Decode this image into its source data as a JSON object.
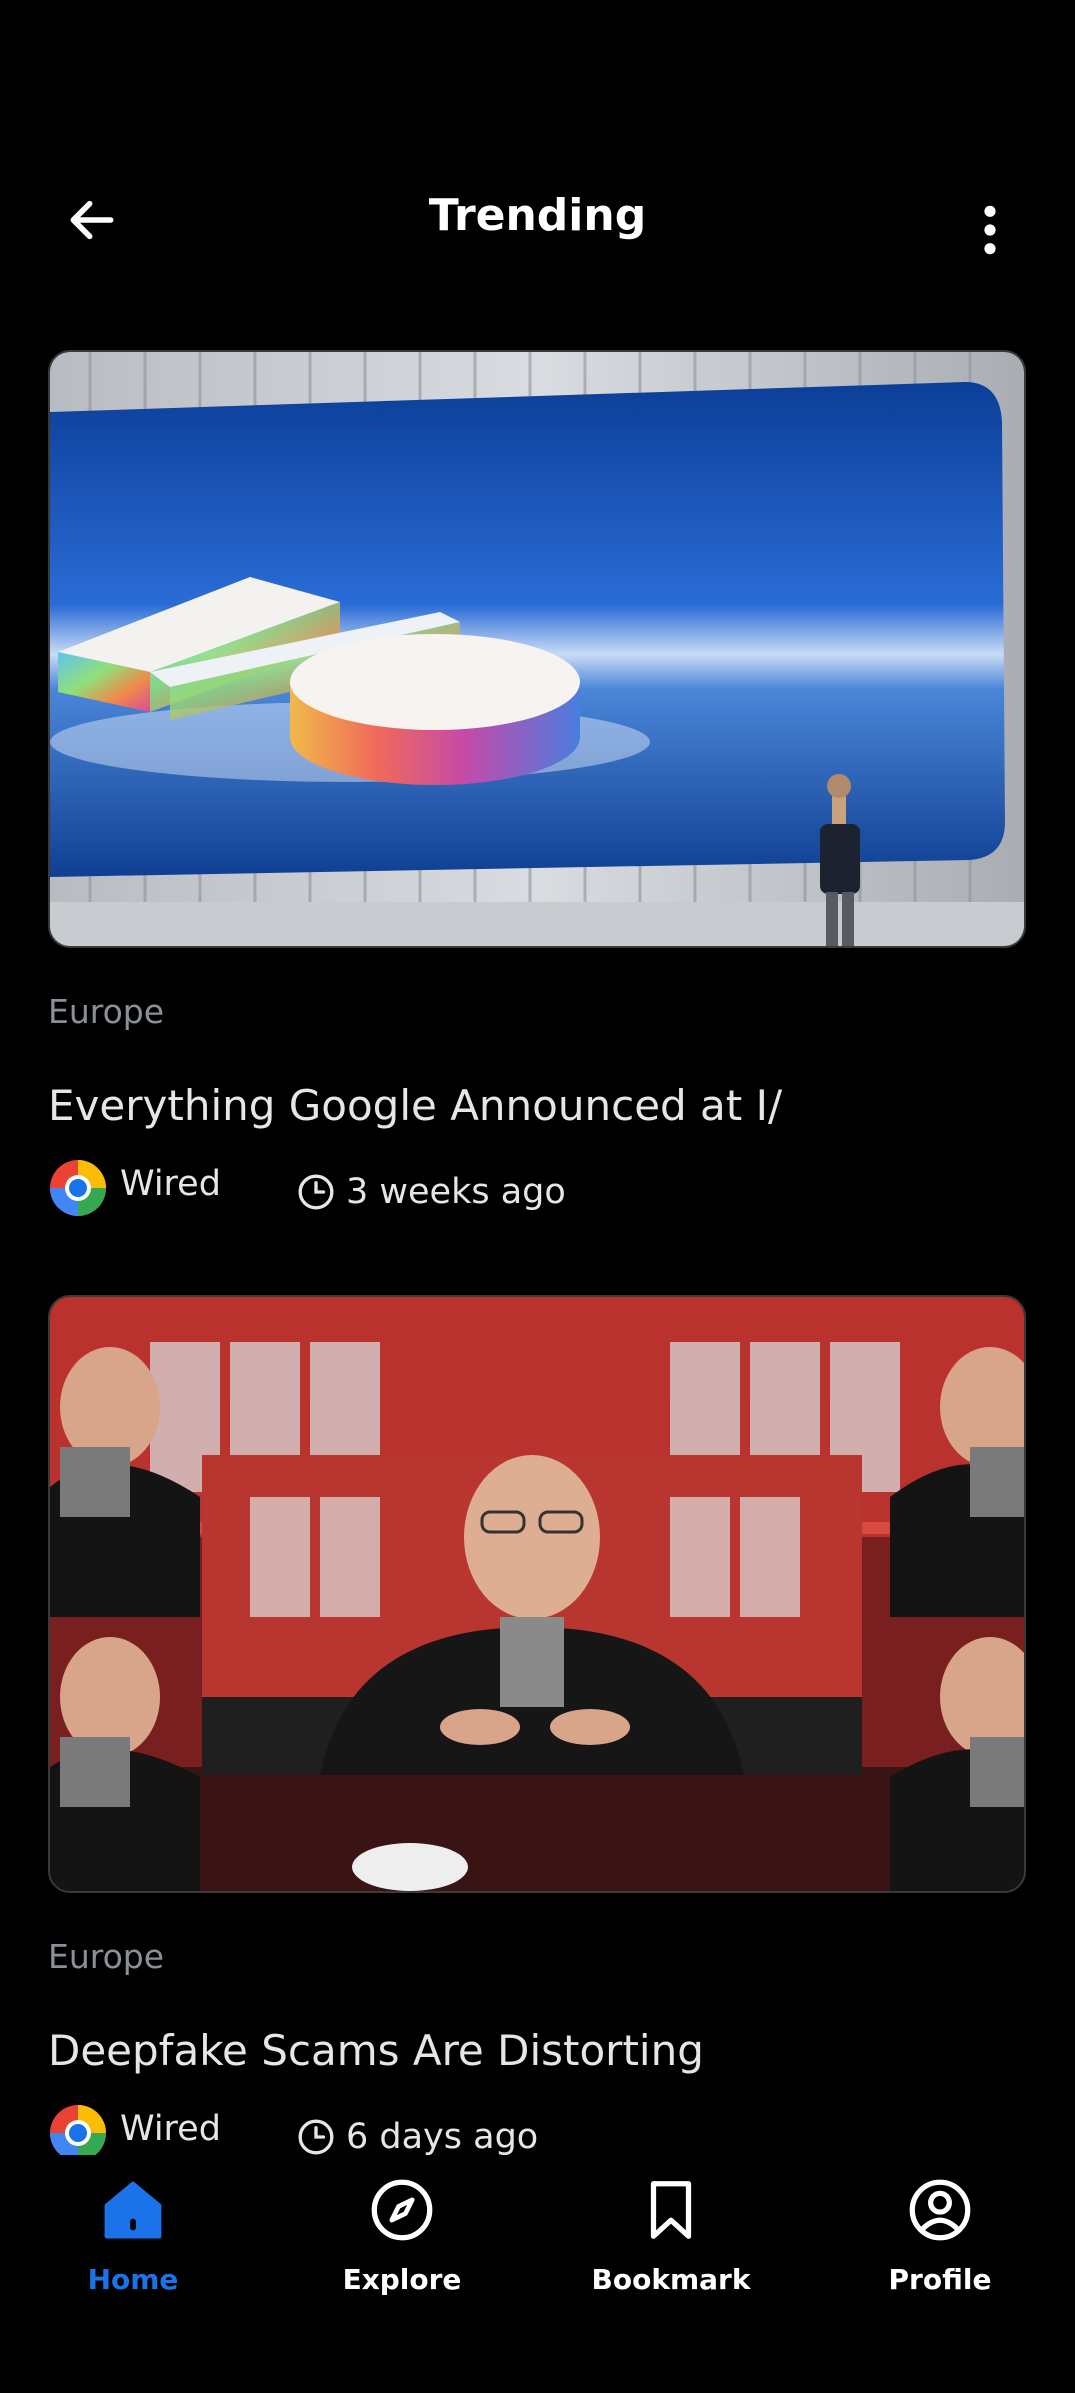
{
  "header": {
    "title": "Trending",
    "back_icon": "arrow-left-icon",
    "more_icon": "more-vertical-icon"
  },
  "articles": [
    {
      "category": "Europe",
      "headline": "Everything Google Announced at I/",
      "source": "Wired",
      "time_ago": "3 weeks ago",
      "image": "stage-keynote-image"
    },
    {
      "category": "Europe",
      "headline": "Deepfake Scams Are Distorting",
      "source": "Wired",
      "time_ago": "6 days ago",
      "image": "deepfake-collage-image"
    }
  ],
  "bottom_nav": {
    "items": [
      {
        "label": "Home",
        "icon": "home-icon",
        "active": true
      },
      {
        "label": "Explore",
        "icon": "compass-icon",
        "active": false
      },
      {
        "label": "Bookmark",
        "icon": "bookmark-icon",
        "active": false
      },
      {
        "label": "Profile",
        "icon": "profile-icon",
        "active": false
      }
    ]
  },
  "colors": {
    "background": "#000000",
    "accent": "#1a73e8",
    "muted_text": "#8a8f99",
    "text": "#e6e6e6"
  }
}
